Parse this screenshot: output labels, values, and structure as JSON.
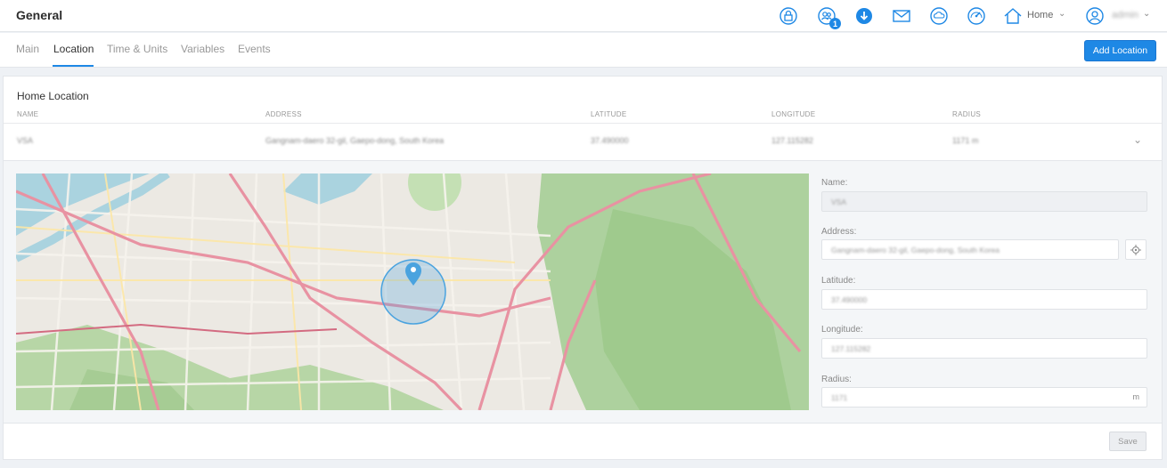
{
  "header": {
    "title": "General",
    "notifications_count": "1",
    "home_label": "Home",
    "user_label": "admin",
    "icons": [
      "lock-icon",
      "users-icon",
      "download-icon",
      "mail-icon",
      "weather-icon",
      "gauge-icon",
      "home-icon",
      "user-icon"
    ]
  },
  "tabs": [
    {
      "label": "Main"
    },
    {
      "label": "Location"
    },
    {
      "label": "Time & Units"
    },
    {
      "label": "Variables"
    },
    {
      "label": "Events"
    }
  ],
  "active_tab": "Location",
  "add_location_label": "Add Location",
  "card": {
    "title": "Home Location",
    "columns": [
      "NAME",
      "ADDRESS",
      "LATITUDE",
      "LONGITUDE",
      "RADIUS"
    ],
    "row": {
      "name": "VSA",
      "address": "Gangnam-daero 32-gil, Gaepo-dong, South Korea",
      "latitude": "37.490000",
      "longitude": "127.115282",
      "radius": "1171 m"
    }
  },
  "form": {
    "name_label": "Name:",
    "name_value": "VSA",
    "address_label": "Address:",
    "address_value": "Gangnam-daero 32-gil, Gaepo-dong, South Korea",
    "latitude_label": "Latitude:",
    "latitude_value": "37.490000",
    "longitude_label": "Longitude:",
    "longitude_value": "127.115282",
    "radius_label": "Radius:",
    "radius_value": "1171",
    "radius_unit": "m",
    "save_label": "Save"
  },
  "colors": {
    "accent": "#1e88e5",
    "map_water": "#aad3df",
    "map_park": "#add19e",
    "map_road": "#e892a2"
  }
}
